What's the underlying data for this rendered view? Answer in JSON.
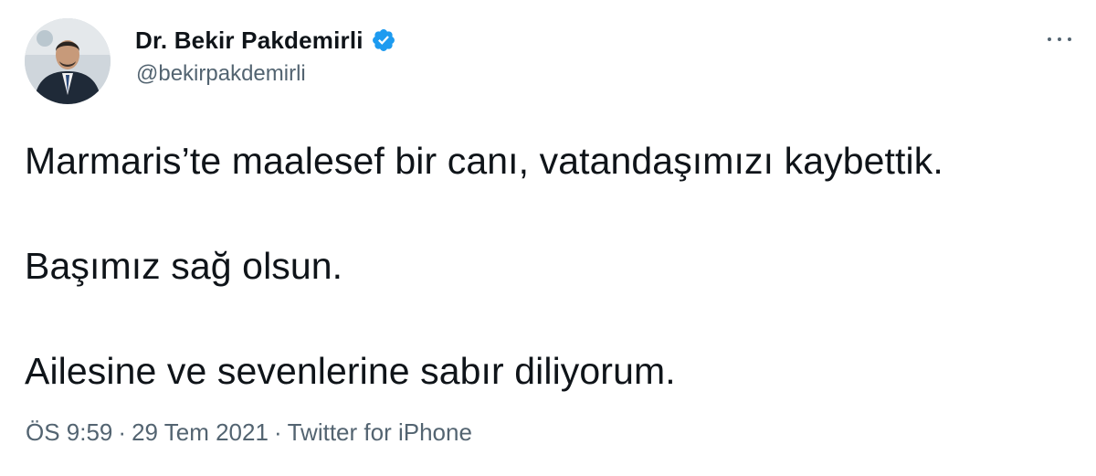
{
  "author": {
    "display_name": "Dr. Bekir Pakdemirli",
    "handle": "@bekirpakdemirli",
    "verified": true,
    "avatar_icon": "profile-photo"
  },
  "tweet": {
    "lines": [
      "Marmaris’te maalesef bir canı, vatandaşımızı kaybettik.",
      "Başımız sağ olsun.",
      "Ailesine ve sevenlerine sabır diliyorum."
    ],
    "time": "ÖS 9:59",
    "date": "29 Tem 2021",
    "separator": "·",
    "source": "Twitter for iPhone"
  },
  "colors": {
    "text": "#0f1419",
    "secondary": "#536471",
    "verified_blue": "#1d9bf0",
    "background": "#ffffff"
  }
}
